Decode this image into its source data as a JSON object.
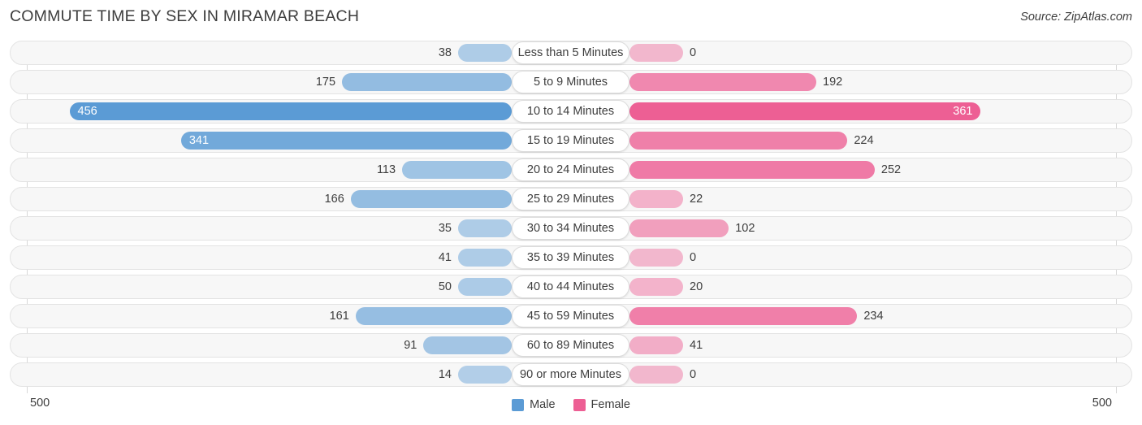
{
  "header": {
    "title": "COMMUTE TIME BY SEX IN MIRAMAR BEACH",
    "source": "Source: ZipAtlas.com"
  },
  "axis": {
    "left_label": "500",
    "right_label": "500",
    "max": 500
  },
  "legend": {
    "items": [
      {
        "label": "Male",
        "color": "#5b9bd5"
      },
      {
        "label": "Female",
        "color": "#ed5f94"
      }
    ]
  },
  "colors": {
    "male": "#5b9bd5",
    "female": "#ed5f94",
    "male_light": "#a8c8ea",
    "female_light": "#f9a1c0",
    "track": "#f7f7f7",
    "track_border": "#e3e3e3",
    "gridline": "#d8d8d8",
    "text": "#3d3d3d"
  },
  "chart_data": {
    "type": "bar",
    "title": "COMMUTE TIME BY SEX IN MIRAMAR BEACH",
    "subtitle": "",
    "orientation": "horizontal-diverging",
    "xlabel": "",
    "ylabel": "",
    "xlim": [
      500,
      500
    ],
    "grid": true,
    "legend_position": "bottom-center",
    "categories": [
      "Less than 5 Minutes",
      "5 to 9 Minutes",
      "10 to 14 Minutes",
      "15 to 19 Minutes",
      "20 to 24 Minutes",
      "25 to 29 Minutes",
      "30 to 34 Minutes",
      "35 to 39 Minutes",
      "40 to 44 Minutes",
      "45 to 59 Minutes",
      "60 to 89 Minutes",
      "90 or more Minutes"
    ],
    "series": [
      {
        "name": "Male",
        "color": "#5b9bd5",
        "values": [
          38,
          175,
          456,
          341,
          113,
          166,
          35,
          41,
          50,
          161,
          91,
          14
        ]
      },
      {
        "name": "Female",
        "color": "#ed5f94",
        "values": [
          0,
          192,
          361,
          224,
          252,
          22,
          102,
          0,
          20,
          234,
          41,
          0
        ]
      }
    ]
  }
}
